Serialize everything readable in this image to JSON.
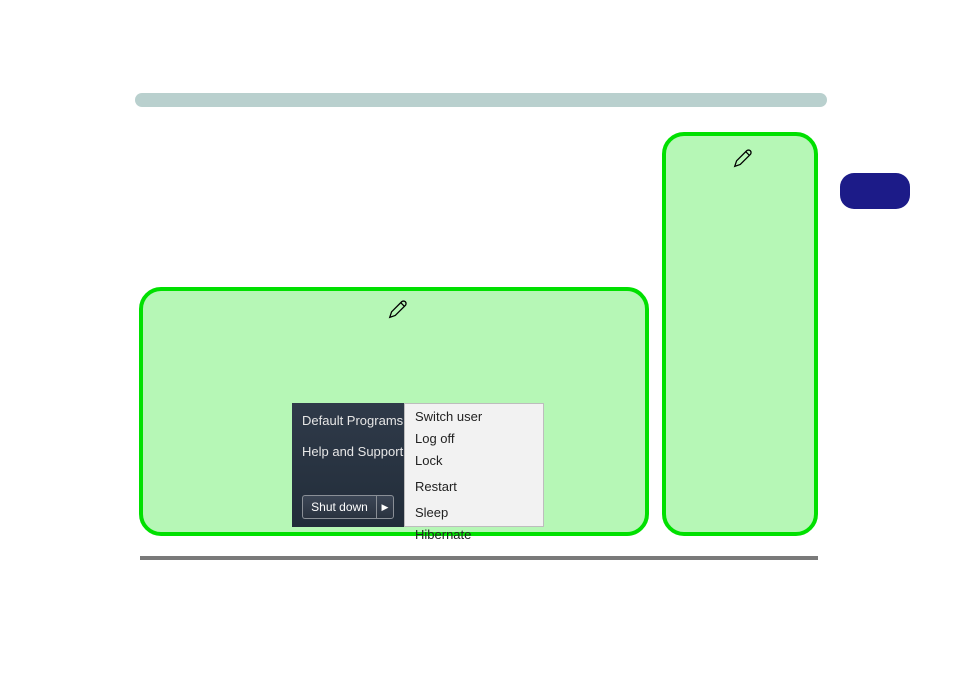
{
  "startmenu": {
    "left_links": [
      {
        "label": "Default Programs"
      },
      {
        "label": "Help and Support"
      }
    ],
    "shutdown_label": "Shut down",
    "power_menu": [
      "Switch user",
      "Log off",
      "Lock",
      "Restart",
      "Sleep",
      "Hibernate"
    ]
  },
  "icons": {
    "edit": "edit-icon",
    "chevron_right": "▶"
  }
}
